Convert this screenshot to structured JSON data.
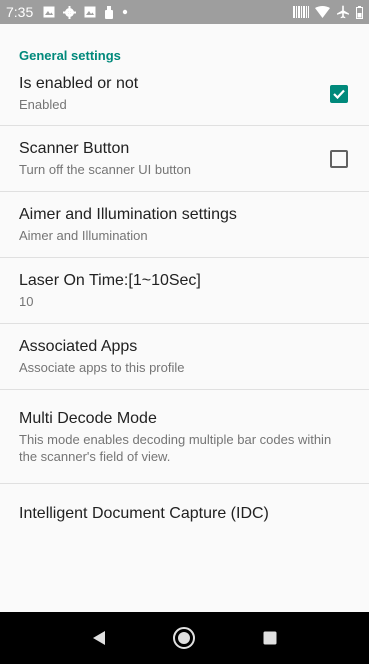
{
  "status_bar": {
    "time": "7:35",
    "left_icons": [
      "image-icon",
      "gear-icon",
      "image-icon",
      "usb-icon",
      "dot-icon"
    ],
    "right_icons": [
      "barcode-icon",
      "wifi-icon",
      "airplane-icon",
      "battery-icon"
    ]
  },
  "section": {
    "title": "General settings"
  },
  "preferences": [
    {
      "title": "Is enabled or not",
      "summary": "Enabled",
      "checkbox": true,
      "checked": true
    },
    {
      "title": "Scanner Button",
      "summary": "Turn off the scanner UI button",
      "checkbox": true,
      "checked": false
    },
    {
      "title": "Aimer and Illumination settings",
      "summary": "Aimer and Illumination"
    },
    {
      "title": "Laser On Time:[1~10Sec]",
      "summary": "10"
    },
    {
      "title": "Associated Apps",
      "summary": "Associate apps to this profile"
    },
    {
      "title": "Multi Decode Mode",
      "summary": "This mode enables decoding multiple bar codes within the scanner's field of view."
    },
    {
      "title": "Intelligent Document Capture (IDC)",
      "summary": ""
    }
  ],
  "nav_bar": {
    "buttons": [
      "back-icon",
      "home-icon",
      "recents-icon"
    ]
  },
  "colors": {
    "accent": "#00897b",
    "status_bar": "#9e9e9e",
    "nav_bar": "#000000"
  }
}
